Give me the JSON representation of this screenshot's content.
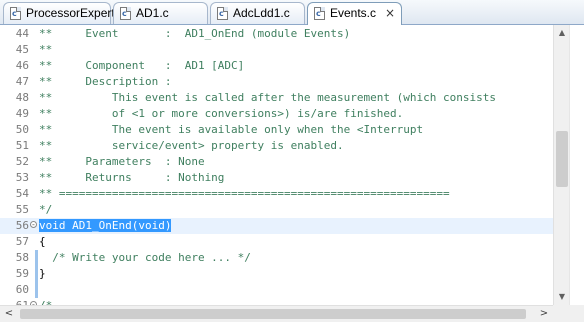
{
  "tabs": [
    {
      "label": "ProcessorExpert.c",
      "icon": "c-file-icon",
      "active": false
    },
    {
      "label": "AD1.c",
      "icon": "c-file-icon",
      "active": false
    },
    {
      "label": "AdcLdd1.c",
      "icon": "c-file-icon",
      "active": false
    },
    {
      "label": "Events.c",
      "icon": "c-file-icon",
      "active": true,
      "close": "×"
    }
  ],
  "file_icon_glyph": "c",
  "editor": {
    "lines": [
      {
        "num": "44",
        "text": "**     Event       :  AD1_OnEnd (module Events)"
      },
      {
        "num": "45",
        "text": "**"
      },
      {
        "num": "46",
        "text": "**     Component   :  AD1 [ADC]"
      },
      {
        "num": "47",
        "text": "**     Description :"
      },
      {
        "num": "48",
        "text": "**         This event is called after the measurement (which consists"
      },
      {
        "num": "49",
        "text": "**         of <1 or more conversions>) is/are finished."
      },
      {
        "num": "50",
        "text": "**         The event is available only when the <Interrupt"
      },
      {
        "num": "51",
        "text": "**         service/event> property is enabled."
      },
      {
        "num": "52",
        "text": "**     Parameters  : None"
      },
      {
        "num": "53",
        "text": "**     Returns     : Nothing"
      },
      {
        "num": "54",
        "text": "** ==========================================================="
      },
      {
        "num": "55",
        "text": "*/"
      },
      {
        "num": "56",
        "text": "void AD1_OnEnd(void)",
        "fold": "-",
        "current": true,
        "selected": true
      },
      {
        "num": "57",
        "text": "{"
      },
      {
        "num": "58",
        "text": "  /* Write your code here ... */"
      },
      {
        "num": "59",
        "text": "}"
      },
      {
        "num": "60",
        "text": ""
      },
      {
        "num": "61",
        "text": "/*",
        "fold": "-"
      }
    ]
  },
  "scrollbars": {
    "vertical_up": "▲",
    "vertical_down": "▼",
    "horizontal_left": "<",
    "horizontal_right": ">"
  },
  "colors": {
    "comment": "#3f7f5f",
    "keyword": "#7f0055",
    "selection": "#3399ff",
    "current_line": "#e8f2fe"
  }
}
